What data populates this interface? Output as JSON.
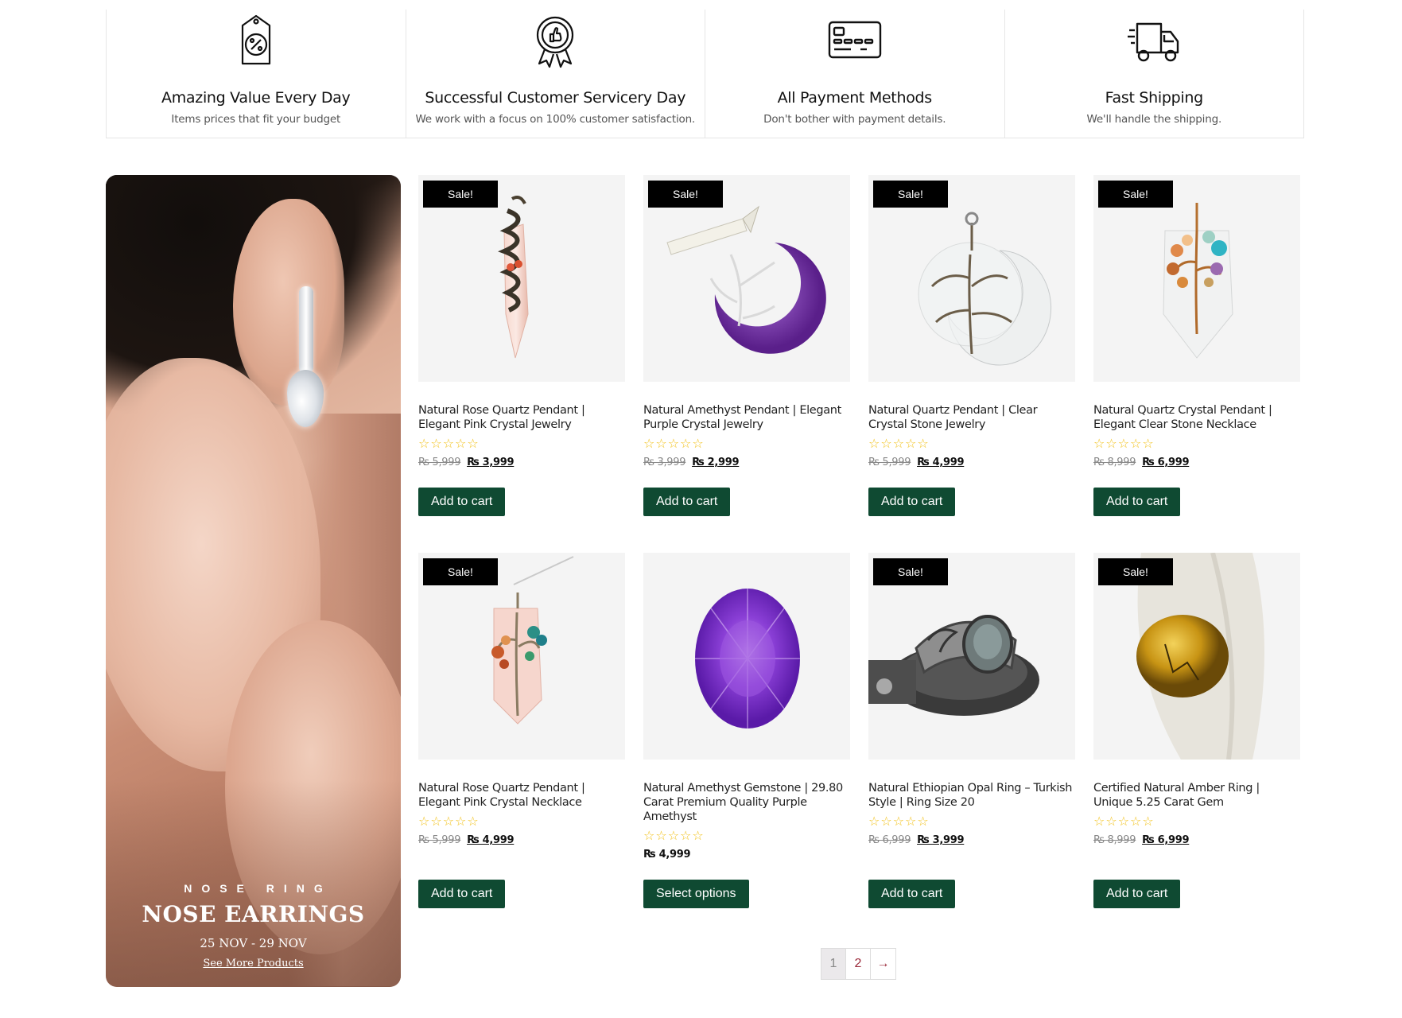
{
  "features": [
    {
      "icon": "discount-tag-icon",
      "title": "Amazing Value Every Day",
      "desc": "Items prices that fit your budget"
    },
    {
      "icon": "award-badge-icon",
      "title": "Successful Customer Servicery Day",
      "desc": "We work with a focus on 100% customer satisfaction."
    },
    {
      "icon": "credit-card-icon",
      "title": "All Payment Methods",
      "desc": "Don't bother with payment details."
    },
    {
      "icon": "delivery-truck-icon",
      "title": "Fast Shipping",
      "desc": "We'll handle the shipping."
    }
  ],
  "banner": {
    "kicker": "NOSE RING",
    "title": "NOSE EARRINGS",
    "date": "25 NOV - 29 NOV",
    "link": "See More Products"
  },
  "sale_label": "Sale!",
  "rating_stars": "☆☆☆☆☆",
  "products": [
    {
      "title": "Natural Rose Quartz Pendant | Elegant Pink Crystal Jewelry",
      "old_price": "₨ 5,999",
      "price": "₨ 3,999",
      "button": "Add to cart",
      "on_sale": true
    },
    {
      "title": "Natural Amethyst Pendant | Elegant Purple Crystal Jewelry",
      "old_price": "₨ 3,999",
      "price": "₨ 2,999",
      "button": "Add to cart",
      "on_sale": true
    },
    {
      "title": "Natural Quartz Pendant | Clear Crystal Stone Jewelry",
      "old_price": "₨ 5,999",
      "price": "₨ 4,999",
      "button": "Add to cart",
      "on_sale": true
    },
    {
      "title": "Natural Quartz Crystal Pendant | Elegant Clear Stone Necklace",
      "old_price": "₨ 8,999",
      "price": "₨ 6,999",
      "button": "Add to cart",
      "on_sale": true
    },
    {
      "title": "Natural Rose Quartz Pendant | Elegant Pink Crystal Necklace",
      "old_price": "₨ 5,999",
      "price": "₨ 4,999",
      "button": "Add to cart",
      "on_sale": true
    },
    {
      "title": "Natural Amethyst Gemstone | 29.80 Carat Premium Quality Purple Amethyst",
      "old_price": "",
      "price": "₨ 4,999",
      "button": "Select options",
      "on_sale": false
    },
    {
      "title": "Natural Ethiopian Opal Ring – Turkish Style | Ring Size 20",
      "old_price": "₨ 6,999",
      "price": "₨ 3,999",
      "button": "Add to cart",
      "on_sale": true
    },
    {
      "title": "Certified Natural Amber Ring | Unique 5.25 Carat Gem",
      "old_price": "₨ 8,999",
      "price": "₨ 6,999",
      "button": "Add to cart",
      "on_sale": true
    }
  ],
  "pagination": {
    "pages": [
      "1",
      "2"
    ],
    "next": "→",
    "current": "1"
  }
}
